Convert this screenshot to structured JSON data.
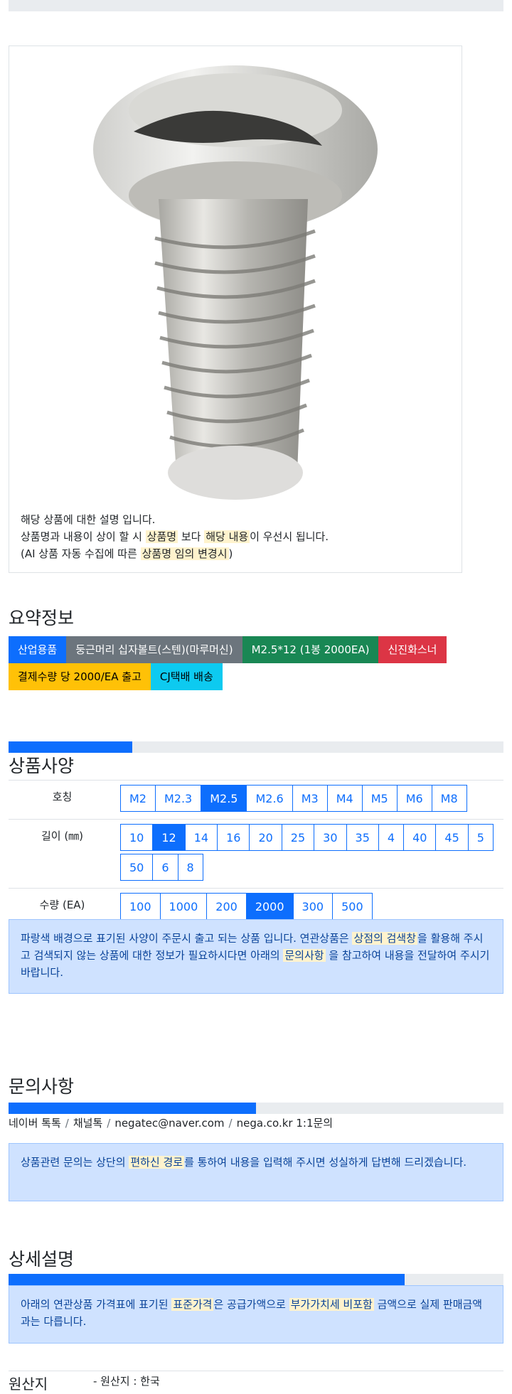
{
  "image_card": {
    "desc_line1": "해당 상품에 대한 설명 입니다.",
    "desc_line2_a": "상품명과 내용이 상이 할 시 ",
    "desc_line2_hl1": "상품명",
    "desc_line2_b": " 보다 ",
    "desc_line2_hl2": "해당 내용",
    "desc_line2_c": "이 우선시 됩니다.",
    "desc_line3_a": "(AI 상품 자동 수집에 따른 ",
    "desc_line3_hl": "상품명 임의 변경시",
    "desc_line3_b": ")"
  },
  "summary": {
    "title": "요약정보",
    "badges": [
      {
        "label": "산업용품",
        "color": "#0d6efd"
      },
      {
        "label": "둥근머리 십자볼트(스텐)(마루머신)",
        "color": "#6c757d"
      },
      {
        "label": "M2.5*12 (1봉 2000EA)",
        "color": "#198754"
      },
      {
        "label": "신진화스너",
        "color": "#dc3545"
      },
      {
        "label": "결제수량 당 2000/EA 출고",
        "color": "#ffc107"
      },
      {
        "label": "CJ택배 배송",
        "color": "#0dcaf0"
      }
    ]
  },
  "spec": {
    "progress": 0.25,
    "title": "상품사양",
    "rows": [
      {
        "label": "호칭",
        "options": [
          "M2",
          "M2.3",
          "M2.5",
          "M2.6",
          "M3",
          "M4",
          "M5",
          "M6",
          "M8"
        ],
        "selected": "M2.5"
      },
      {
        "label": "길이 (㎜)",
        "options": [
          "10",
          "12",
          "14",
          "16",
          "20",
          "25",
          "30",
          "35",
          "4",
          "40",
          "45",
          "5",
          "50",
          "6",
          "8"
        ],
        "selected": "12"
      },
      {
        "label": "수량 (EA)",
        "options": [
          "100",
          "1000",
          "200",
          "2000",
          "300",
          "500"
        ],
        "selected": "2000"
      }
    ],
    "notice_a": "파랑색 배경으로 표기된 사양이 주문시 출고 되는 상품 입니다. 연관상품은 ",
    "notice_hl1": "상점의 검색창",
    "notice_b": "을 활용해 주시고 검색되지 않는 상품에 대한 정보가 필요하시다면 아래의 ",
    "notice_hl2": "문의사항",
    "notice_c": " 을 참고하여 내용을 전달하여 주시기 바랍니다."
  },
  "inquiry": {
    "title": "문의사항",
    "progress": 0.5,
    "contacts": [
      "네이버 톡톡",
      "채널톡",
      "negatec@naver.com",
      "nega.co.kr 1:1문의"
    ],
    "notice_a": "상품관련 문의는 상단의 ",
    "notice_hl": "편하신 경로",
    "notice_b": "를 통하여 내용을 입력해 주시면 성실하게 답변해 드리겠습니다."
  },
  "detail": {
    "title": "상세설명",
    "progress": 0.8,
    "notice_a": "아래의 연관상품 가격표에 표기된 ",
    "notice_hl1": "표준가격",
    "notice_b": "은 공급가액으로 ",
    "notice_hl2": "부가가치세 비포함",
    "notice_c": " 금액으로 실제 판매금액과는 다릅니다."
  },
  "origin": {
    "label": "원산지",
    "value": "- 원산지 : 한국"
  }
}
